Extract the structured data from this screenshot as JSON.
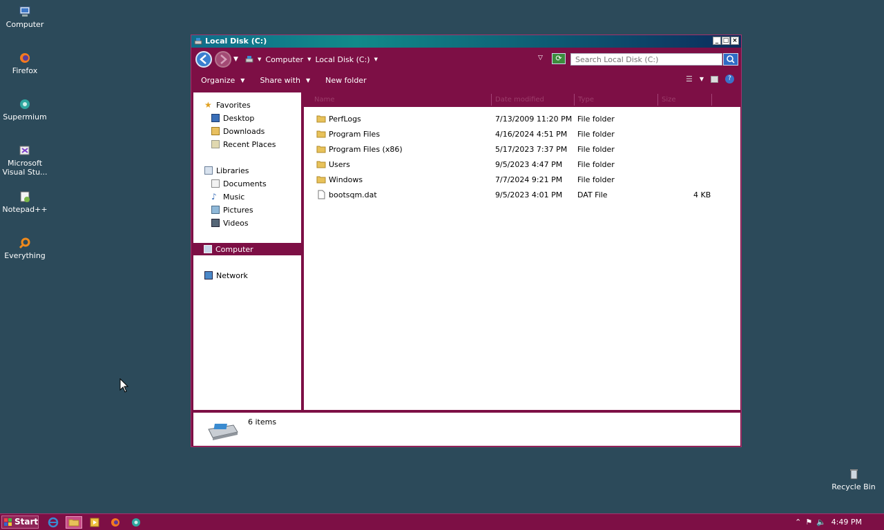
{
  "desktop": {
    "icons": [
      {
        "label": "Computer"
      },
      {
        "label": "Firefox"
      },
      {
        "label": "Supermium"
      },
      {
        "label": "Microsoft Visual Stu..."
      },
      {
        "label": "Notepad++"
      },
      {
        "label": "Everything"
      }
    ],
    "recycle_bin": "Recycle Bin"
  },
  "window": {
    "title": "Local Disk (C:)",
    "breadcrumb": [
      "Computer",
      "Local Disk (C:)"
    ],
    "search_placeholder": "Search Local Disk (C:)",
    "toolbar": {
      "organize": "Organize",
      "share_with": "Share with",
      "new_folder": "New folder"
    },
    "nav": {
      "favorites": "Favorites",
      "desktop": "Desktop",
      "downloads": "Downloads",
      "recent_places": "Recent Places",
      "libraries": "Libraries",
      "documents": "Documents",
      "music": "Music",
      "pictures": "Pictures",
      "videos": "Videos",
      "computer": "Computer",
      "network": "Network"
    },
    "columns": {
      "name": "Name",
      "date_modified": "Date modified",
      "type": "Type",
      "size": "Size"
    },
    "files": [
      {
        "name": "PerfLogs",
        "date": "7/13/2009 11:20 PM",
        "type": "File folder",
        "size": ""
      },
      {
        "name": "Program Files",
        "date": "4/16/2024 4:51 PM",
        "type": "File folder",
        "size": ""
      },
      {
        "name": "Program Files (x86)",
        "date": "5/17/2023 7:37 PM",
        "type": "File folder",
        "size": ""
      },
      {
        "name": "Users",
        "date": "9/5/2023 4:47 PM",
        "type": "File folder",
        "size": ""
      },
      {
        "name": "Windows",
        "date": "7/7/2024 9:21 PM",
        "type": "File folder",
        "size": ""
      },
      {
        "name": "bootsqm.dat",
        "date": "9/5/2023 4:01 PM",
        "type": "DAT File",
        "size": "4 KB"
      }
    ],
    "status": "6 items"
  },
  "taskbar": {
    "start": "Start",
    "clock": "4:49 PM"
  },
  "colors": {
    "window_frame": "#7d0f45",
    "desktop": "#2c4a5a"
  }
}
